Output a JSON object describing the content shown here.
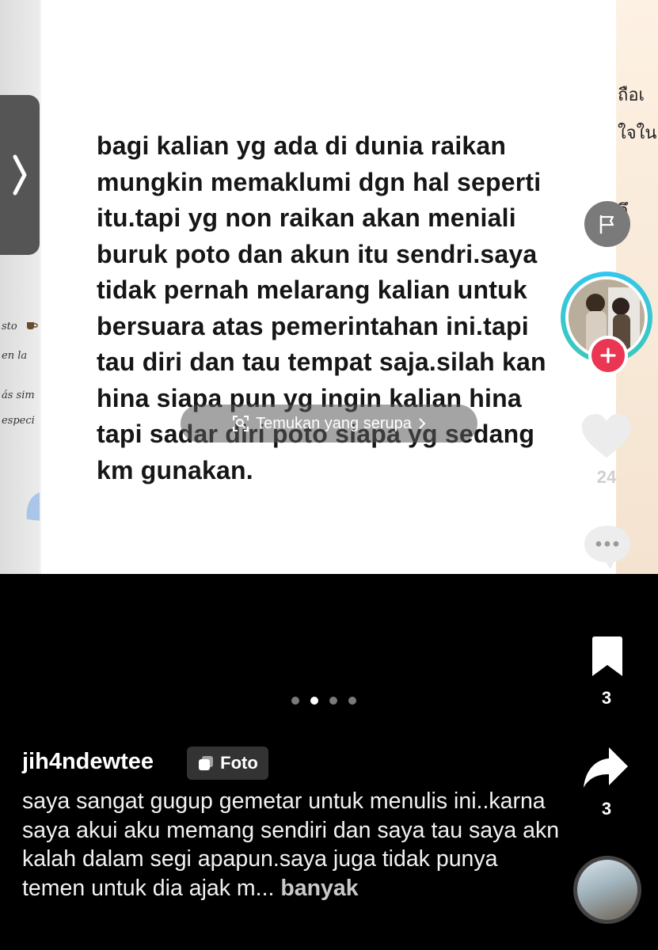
{
  "post": {
    "text": "bagi kalian yg ada di dunia raikan mungkin memaklumi dgn hal seperti itu.tapi yg non raikan akan meniali buruk poto dan akun itu sendri.saya tidak pernah melarang kalian untuk bersuara atas pemerintahan ini.tapi tau diri dan tau tempat saja.silah kan hina siapa pun yg ingin kalian hina tapi sadar diri poto siapa yg sedang km gunakan."
  },
  "prev_photo_text": [
    "sto",
    "en la",
    "ás sim",
    "especi"
  ],
  "next_photo_text": [
    "ถือเ",
    "ใจใน",
    "ถึ"
  ],
  "similar_search": {
    "label": "Temukan yang serupa",
    "icon": "visual-search-icon"
  },
  "actions": {
    "like_count": "24",
    "bookmark_count": "3",
    "share_count": "3"
  },
  "carousel": {
    "total": 4,
    "active_index": 1
  },
  "author": {
    "username": "jih4ndewtee",
    "badge_label": "Foto"
  },
  "caption": {
    "text": "saya sangat gugup gemetar untuk menulis ini..karna saya akui aku memang sendiri dan saya tau saya akn kalah dalam segi apapun.saya juga tidak punya temen untuk dia ajak m...",
    "more_label": "banyak"
  },
  "colors": {
    "follow_plus": "#ea3553",
    "avatar_ring": "#33c6f2",
    "background": "#000000"
  }
}
